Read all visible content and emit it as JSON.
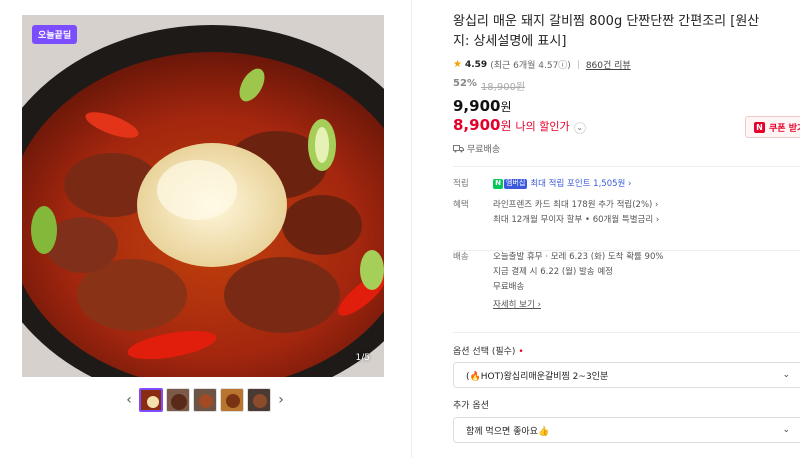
{
  "gallery": {
    "badge": "오늘끝딜",
    "counter": "1/5",
    "prev_icon": "chevron-left-icon",
    "next_icon": "chevron-right-icon",
    "thumb_count": 5
  },
  "product": {
    "title": "왕십리 매운 돼지 갈비찜 800g 단짠단짠 간편조리 [원산지: 상세설명에 표시]",
    "rating": {
      "star": "★",
      "score": "4.59",
      "recent": "(최근 6개월 4.57ⓘ)",
      "reviews": "860건 리뷰"
    },
    "discount": "52%",
    "original_price": "18,900원",
    "price": "9,900",
    "price_unit": "원",
    "my_price": "8,900",
    "my_price_unit": "원",
    "my_price_label": "나의 할인가",
    "my_price_caret": "⌄",
    "coupon": {
      "n": "N",
      "label": "쿠폰 받기"
    },
    "shipping_tag": "무료배송"
  },
  "details": {
    "points_key": "적립",
    "points_value": "최대 적립 포인트 1,505원 ›",
    "npay_n": "N",
    "npay_plus": "멤버십",
    "benefit_key": "혜택",
    "benefit_line1": "라인프렌즈 카드 최대 178원 추가 적립(2%) ›",
    "benefit_line2": "최대 12개월 무이자 할부 • 60개월 특별금리 ›",
    "delivery_key": "배송",
    "delivery_line1": "오늘출발 휴무 · 모레 6.23 (화) 도착 확률 90%",
    "delivery_line2": "지금 결제 시 6.22 (월) 발송 예정",
    "delivery_line3": "무료배송",
    "detail_link": "자세히 보기 ›"
  },
  "options": {
    "required_label": "옵션 선택 (필수)",
    "required_mark": "•",
    "required_value": "(🔥HOT)왕십리매운갈비찜 2~3인분",
    "extra_label": "추가 옵션",
    "extra_value": "함께 먹으면 좋아요👍"
  },
  "colors": {
    "accent": "#7b4dff",
    "sale": "#e5002b",
    "link": "#3b5bdb",
    "npay": "#03c75a"
  }
}
